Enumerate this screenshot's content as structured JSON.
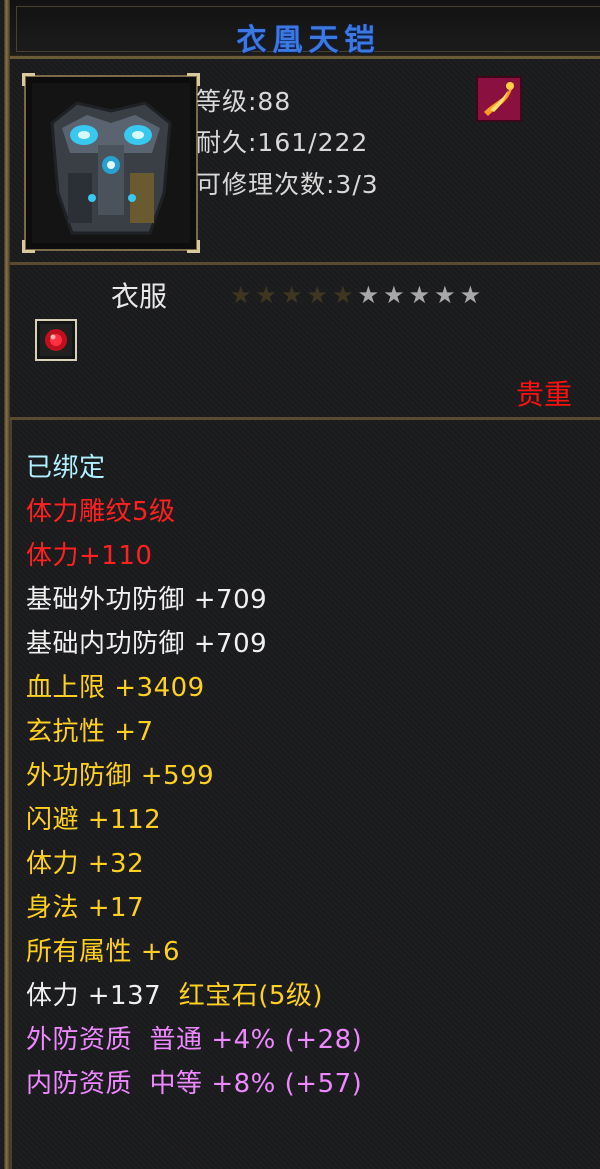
{
  "item": {
    "name": "衣凰天铠",
    "level_label": "等级:88",
    "durability_label": "耐久:161/222",
    "repair_label": "可修理次数:3/3",
    "category": "衣服",
    "rarity": "贵重",
    "stars": {
      "total": 10,
      "dim": 5
    },
    "icons": {
      "portrait": "armor-portrait-icon",
      "gem": "fire-gem-icon",
      "socket": "red-socket-icon"
    }
  },
  "attributes": [
    {
      "text": "已绑定",
      "color": "cyan"
    },
    {
      "text": "体力雕纹5级",
      "color": "red"
    },
    {
      "text": "体力+110",
      "color": "red"
    },
    {
      "text": "基础外功防御 +709",
      "color": "white"
    },
    {
      "text": "基础内功防御 +709",
      "color": "white"
    },
    {
      "text": "血上限 +3409",
      "color": "yellow"
    },
    {
      "text": "玄抗性 +7",
      "color": "yellow"
    },
    {
      "text": "外功防御 +599",
      "color": "yellow"
    },
    {
      "text": "闪避 +112",
      "color": "yellow"
    },
    {
      "text": "体力 +32",
      "color": "yellow"
    },
    {
      "text": "身法 +17",
      "color": "yellow"
    },
    {
      "text": "所有属性 +6",
      "color": "yellow"
    }
  ],
  "gem_line": {
    "stat": "体力 +137",
    "gem": "红宝石(5级)"
  },
  "aptitudes": [
    {
      "label": "外防资质",
      "grade": "普通",
      "value": "+4%",
      "bonus": "(+28)"
    },
    {
      "label": "内防资质",
      "grade": "中等",
      "value": "+8%",
      "bonus": "(+57)"
    }
  ],
  "colors": {
    "title": "#3d78e0",
    "rarity": "#ff1010",
    "bound": "#b0f0ff",
    "engrave": "#ff2020",
    "base": "#f0f0f0",
    "bonus": "#ffd020",
    "aptitude": "#ee88ff"
  }
}
